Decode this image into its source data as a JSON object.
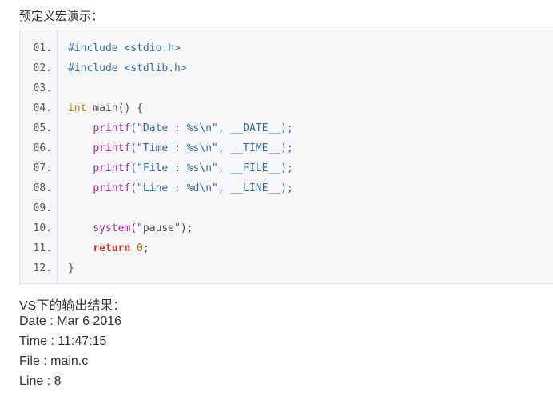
{
  "heading": "预定义宏演示：",
  "code_lines": [
    {
      "no": "01.",
      "tokens": [
        {
          "t": "#include <stdio.h>",
          "c": "tok-str"
        }
      ]
    },
    {
      "no": "02.",
      "tokens": [
        {
          "t": "#include <stdlib.h>",
          "c": "tok-str"
        }
      ]
    },
    {
      "no": "03.",
      "tokens": []
    },
    {
      "no": "04.",
      "tokens": [
        {
          "t": "int",
          "c": "tok-kw"
        },
        {
          "t": " main() {",
          "c": ""
        }
      ]
    },
    {
      "no": "05.",
      "tokens": [
        {
          "t": "    ",
          "c": ""
        },
        {
          "t": "printf",
          "c": "tok-fn"
        },
        {
          "t": "(\"Date : %s\\n\", __DATE__);",
          "c": "tok-str"
        }
      ]
    },
    {
      "no": "06.",
      "tokens": [
        {
          "t": "    ",
          "c": ""
        },
        {
          "t": "printf",
          "c": "tok-fn"
        },
        {
          "t": "(\"Time : %s\\n\", __TIME__);",
          "c": "tok-str"
        }
      ]
    },
    {
      "no": "07.",
      "tokens": [
        {
          "t": "    ",
          "c": ""
        },
        {
          "t": "printf",
          "c": "tok-fn"
        },
        {
          "t": "(\"File : %s\\n\", __FILE__);",
          "c": "tok-str"
        }
      ]
    },
    {
      "no": "08.",
      "tokens": [
        {
          "t": "    ",
          "c": ""
        },
        {
          "t": "printf",
          "c": "tok-fn"
        },
        {
          "t": "(\"Line : %d\\n\", __LINE__);",
          "c": "tok-str"
        }
      ]
    },
    {
      "no": "09.",
      "tokens": []
    },
    {
      "no": "10.",
      "tokens": [
        {
          "t": "    ",
          "c": ""
        },
        {
          "t": "system",
          "c": "tok-fn"
        },
        {
          "t": "(\"pause\");",
          "c": ""
        }
      ]
    },
    {
      "no": "11.",
      "tokens": [
        {
          "t": "    ",
          "c": ""
        },
        {
          "t": "return",
          "c": "tok-ret"
        },
        {
          "t": " ",
          "c": ""
        },
        {
          "t": "0",
          "c": "tok-num"
        },
        {
          "t": ";",
          "c": ""
        }
      ]
    },
    {
      "no": "12.",
      "tokens": [
        {
          "t": "}",
          "c": ""
        }
      ]
    }
  ],
  "output_heading": "VS下的输出结果：",
  "output_lines": [
    "Date : Mar  6 2016",
    "Time : 11:47:15",
    "File : main.c",
    "Line : 8"
  ]
}
